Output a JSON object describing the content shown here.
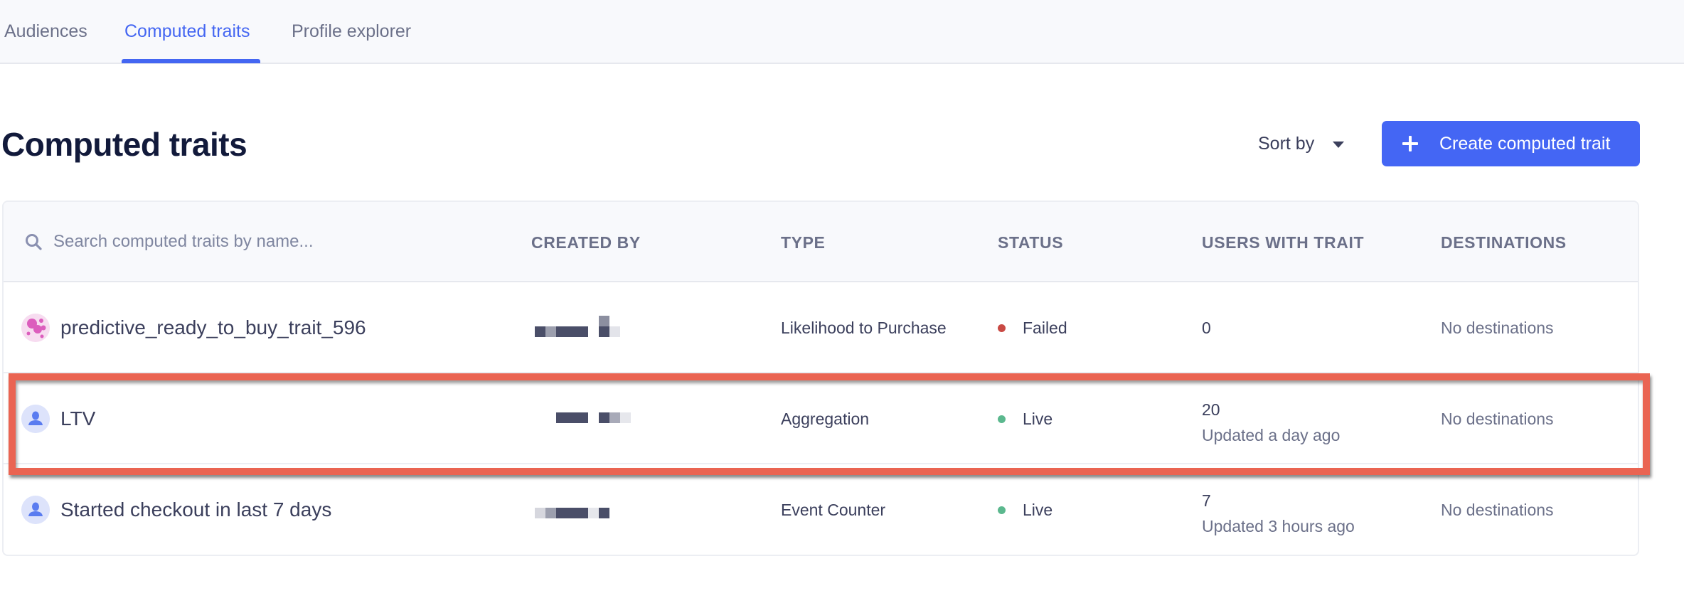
{
  "tabs": [
    {
      "label": "Audiences",
      "active": false
    },
    {
      "label": "Computed traits",
      "active": true
    },
    {
      "label": "Profile explorer",
      "active": false
    }
  ],
  "page": {
    "title": "Computed traits",
    "sort_by_label": "Sort by",
    "create_button_label": "Create computed trait"
  },
  "table": {
    "search_placeholder": "Search computed traits by name...",
    "search_value": "",
    "columns": [
      "CREATED BY",
      "TYPE",
      "STATUS",
      "USERS WITH TRAIT",
      "DESTINATIONS"
    ],
    "rows": [
      {
        "name": "predictive_ready_to_buy_trait_596",
        "icon": "predictive-icon",
        "created_by": "[redacted]",
        "type": "Likelihood to Purchase",
        "status": "Failed",
        "status_color": "#c94a44",
        "users_count": "0",
        "users_updated": "",
        "destinations": "No destinations"
      },
      {
        "name": "LTV",
        "icon": "user-icon",
        "created_by": "[redacted]",
        "type": "Aggregation",
        "status": "Live",
        "status_color": "#5bb88e",
        "users_count": "20",
        "users_updated": "Updated a day ago",
        "destinations": "No destinations",
        "highlighted": true
      },
      {
        "name": "Started checkout in last 7 days",
        "icon": "user-icon",
        "created_by": "[redacted]",
        "type": "Event Counter",
        "status": "Live",
        "status_color": "#5bb88e",
        "users_count": "7",
        "users_updated": "Updated 3 hours ago",
        "destinations": "No destinations"
      }
    ]
  },
  "colors": {
    "accent": "#4466f4",
    "highlight": "#ea6452",
    "title": "#121a3b"
  }
}
